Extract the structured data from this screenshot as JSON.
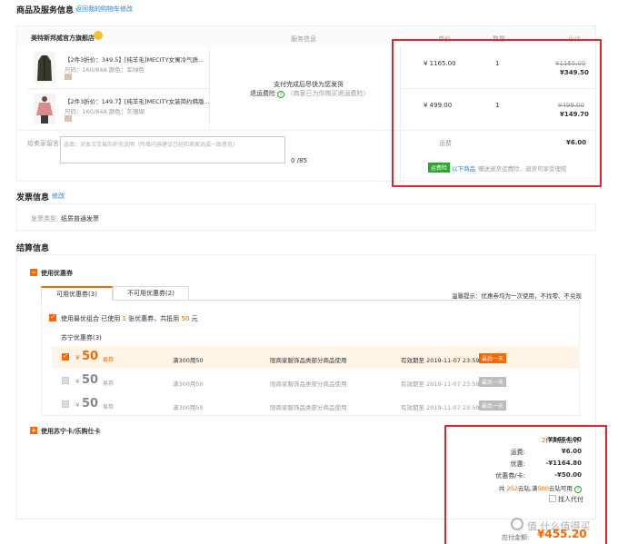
{
  "goods": {
    "title": "商品及服务信息",
    "back_link": "返回我的购物车修改",
    "store_name": "美特斯邦威官方旗舰店",
    "col_service": "服务信息",
    "col_price": "单价",
    "col_qty": "数量",
    "col_subtotal": "小计",
    "items": [
      {
        "name": "【2件3折价：349.5】[纯羊毛]MECITY女寓冷气质...",
        "spec": "尺码：160/84A   颜色：军绿色",
        "price": "¥ 1165.00",
        "qty": "1",
        "orig_subtotal": "¥1165.00",
        "subtotal": "¥349.50"
      },
      {
        "name": "【2件3折价：149.7】[纯羊毛]MECITY女装简约韩版...",
        "spec": "尺码：160/84A   颜色：灰珊瑚",
        "price": "¥ 499.00",
        "qty": "1",
        "orig_subtotal": "¥499.00",
        "subtotal": "¥149.70"
      }
    ],
    "service_line1": "支付完成后尽快为您发货",
    "service_line2_label": "退运费险",
    "service_line2_note": "（商家已为你购买退运费险）",
    "message_label": "给卖家留言:",
    "message_placeholder": "选填：对本次交易的补充说明（所填内容建议已经和卖家达成一致意见）",
    "message_count": "0 /85",
    "shipping_label": "运费",
    "shipping_value": "¥6.00",
    "freight_tag": "运费险",
    "freight_text": "以下商品",
    "freight_note": "赠送退货运费险，退货可享受理赔"
  },
  "invoice": {
    "title": "发票信息",
    "edit": "修改",
    "type_label": "发票类型:",
    "type_value": "纸质普通发票"
  },
  "settle": {
    "title": "结算信息",
    "use_coupon": "使用优惠券",
    "tab_usable": "可用优惠券(3)",
    "tab_unusable": "不可用优惠券(2)",
    "tip": "温馨提示：优惠券均为一次使用，不找零、不兑现",
    "best_combo_prefix": "使用最优组合  已使用",
    "best_combo_count": "1",
    "best_combo_mid": "张优惠券，共抵用",
    "best_combo_amount": "50",
    "best_combo_suffix": "元",
    "group": "苏宁优惠券(3)",
    "coupons": [
      {
        "currency": "¥",
        "amount": "50",
        "kind": "易券",
        "cond": "满300用50",
        "scope": "限商家服饰品类部分商品使用",
        "valid": "有效期至 2019-11-07 23:59",
        "tag": "最后一天"
      },
      {
        "currency": "¥",
        "amount": "50",
        "kind": "易券",
        "cond": "满300用50",
        "scope": "限商家服饰品类部分商品使用",
        "valid": "有效期至 2019-11-07 23:59",
        "tag": "最后一天"
      },
      {
        "currency": "¥",
        "amount": "50",
        "kind": "易券",
        "cond": "满300用50",
        "scope": "限商家服饰品类部分商品使用",
        "valid": "有效期至 2019-11-07 23:59",
        "tag": "最后一天"
      }
    ],
    "use_card": "使用苏宁卡/乐购仕卡"
  },
  "summary": {
    "items_count": "2",
    "items_label": "件商品,总计:",
    "items_total": "¥1664.00",
    "shipping_label": "运费:",
    "shipping_value": "¥6.00",
    "discount_label": "优惠:",
    "discount_value": "-¥1164.80",
    "coupon_label": "优惠券/卡:",
    "coupon_value": "-¥50.00",
    "yunzuan_prefix": "共",
    "yunzuan_count": "252",
    "yunzuan_mid": "云钻,满",
    "yunzuan_min": "500",
    "yunzuan_suffix": "云钻可用",
    "proxy_pay": "找人代付",
    "payable_label": "应付金额:",
    "payable_value": "¥455.20"
  },
  "watermark": "值 什么值得买",
  "colors": {
    "accent": "#ff6600",
    "link": "#2d7fd3",
    "highlight": "#e0262e",
    "green": "#2aa72a"
  }
}
